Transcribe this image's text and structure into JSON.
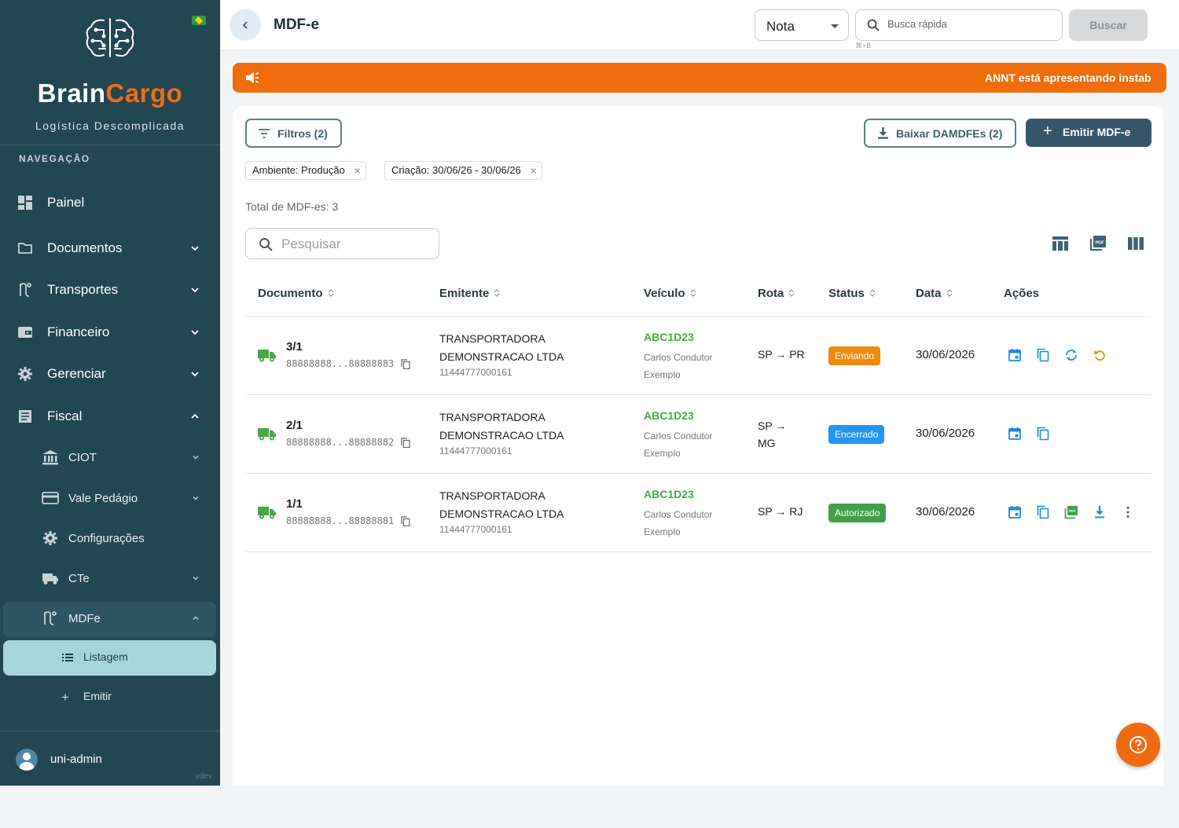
{
  "sidebar": {
    "brand_part1": "Brain",
    "brand_part2": "Cargo",
    "tagline": "Logística Descomplicada",
    "nav_title": "NAVEGAÇÃO",
    "items": [
      {
        "label": "Painel",
        "icon": "dashboard-icon"
      },
      {
        "label": "Documentos",
        "icon": "folder-icon"
      },
      {
        "label": "Transportes",
        "icon": "route-icon"
      },
      {
        "label": "Financeiro",
        "icon": "wallet-icon"
      },
      {
        "label": "Gerenciar",
        "icon": "gear-icon"
      },
      {
        "label": "Fiscal",
        "icon": "receipt-icon"
      }
    ],
    "fiscal_sub": [
      {
        "label": "CIOT",
        "icon": "bank-icon"
      },
      {
        "label": "Vale Pedágio",
        "icon": "card-icon"
      },
      {
        "label": "Configurações",
        "icon": "gear-icon"
      },
      {
        "label": "CTe",
        "icon": "truck-icon"
      },
      {
        "label": "MDFe",
        "icon": "route-icon"
      }
    ],
    "mdfe_sub": {
      "listagem": "Listagem",
      "emitir": "Emitir"
    },
    "username": "uni-admin",
    "version": "vdev"
  },
  "topbar": {
    "title": "MDF-e",
    "select_value": "Nota",
    "search_placeholder": "Busca rápida",
    "shortcut": "⌘+B",
    "buscar_label": "Buscar"
  },
  "banner": {
    "message": "ANNT está apresentando instab"
  },
  "toolbar": {
    "filter_label": "Filtros (2)",
    "baixar_label": "Baixar DAMDFEs (2)",
    "emitir_label": "Emitir MDF-e"
  },
  "chips": [
    "Ambiente: Produção",
    "Criação: 30/06/26 - 30/06/26"
  ],
  "total": "Total de MDF-es: 3",
  "table_search_placeholder": "Pesquisar",
  "columns": [
    "Documento",
    "Emitente",
    "Veículo",
    "Rota",
    "Status",
    "Data",
    "Ações"
  ],
  "rows": [
    {
      "doc": "3/1",
      "key": "88888888...88888883",
      "emitente": "TRANSPORTADORA DEMONSTRACAO LTDA",
      "cnpj": "11444777000161",
      "plate": "ABC1D23",
      "driver": "Carlos Condutor Exemplo",
      "route": "SP → PR",
      "status": "Enviando",
      "status_color": "#f08a0c",
      "date": "30/06/2026"
    },
    {
      "doc": "2/1",
      "key": "88888888...88888882",
      "emitente": "TRANSPORTADORA DEMONSTRACAO LTDA",
      "cnpj": "11444777000161",
      "plate": "ABC1D23",
      "driver": "Carlos Condutor Exemplo",
      "route": "SP → MG",
      "status": "Encerrado",
      "status_color": "#2196f3",
      "date": "30/06/2026"
    },
    {
      "doc": "1/1",
      "key": "88888888...88888881",
      "emitente": "TRANSPORTADORA DEMONSTRACAO LTDA",
      "cnpj": "11444777000161",
      "plate": "ABC1D23",
      "driver": "Carlos Condutor Exemplo",
      "route": "SP → RJ",
      "status": "Autorizado",
      "status_color": "#43a047",
      "date": "30/06/2026"
    }
  ],
  "colors": {
    "sidebar": "#234653",
    "accent": "#ef6d0d",
    "primary": "#38566a",
    "action_blue": "#1e88e5"
  }
}
